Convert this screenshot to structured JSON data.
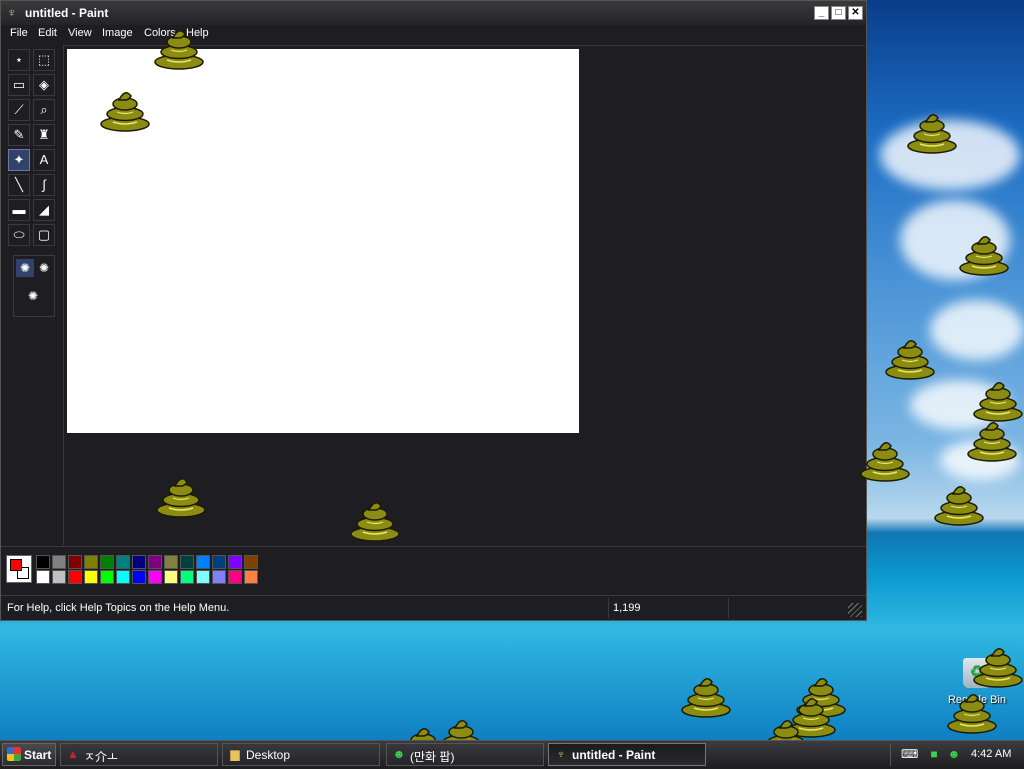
{
  "window": {
    "title": "untitled - Paint",
    "app_icon": "paint-brush-icon",
    "minimize_icon": "minimize-icon",
    "maximize_icon": "maximize-icon",
    "close_icon": "close-icon"
  },
  "menu": [
    "File",
    "Edit",
    "View",
    "Image",
    "Colors",
    "Help"
  ],
  "tools": [
    {
      "name": "free-form-select-icon",
      "glyph": "⋆"
    },
    {
      "name": "rect-select-icon",
      "glyph": "⬚"
    },
    {
      "name": "eraser-icon",
      "glyph": "▭"
    },
    {
      "name": "fill-bucket-icon",
      "glyph": "◈"
    },
    {
      "name": "color-picker-icon",
      "glyph": "⟋"
    },
    {
      "name": "magnifier-icon",
      "glyph": "⌕"
    },
    {
      "name": "pencil-icon",
      "glyph": "✎"
    },
    {
      "name": "brush-icon",
      "glyph": "♜"
    },
    {
      "name": "airbrush-icon",
      "glyph": "✦",
      "selected": true
    },
    {
      "name": "text-icon",
      "glyph": "A"
    },
    {
      "name": "line-icon",
      "glyph": "╲"
    },
    {
      "name": "curve-icon",
      "glyph": "∫"
    },
    {
      "name": "rectangle-icon",
      "glyph": "▬"
    },
    {
      "name": "polygon-icon",
      "glyph": "◢"
    },
    {
      "name": "ellipse-icon",
      "glyph": "⬭"
    },
    {
      "name": "rounded-rect-icon",
      "glyph": "▢"
    }
  ],
  "colors": {
    "foreground": "#ff0000",
    "background": "#ffffff",
    "row1": [
      "#000000",
      "#808080",
      "#800000",
      "#808000",
      "#008000",
      "#008080",
      "#000080",
      "#800080",
      "#808040",
      "#004040",
      "#0080ff",
      "#004080",
      "#8000ff",
      "#804000"
    ],
    "row2": [
      "#ffffff",
      "#c0c0c0",
      "#ff0000",
      "#ffff00",
      "#00ff00",
      "#00ffff",
      "#0000ff",
      "#ff00ff",
      "#ffff80",
      "#00ff80",
      "#80ffff",
      "#8080ff",
      "#ff0080",
      "#ff8040"
    ]
  },
  "status": {
    "help_text": "For Help, click Help Topics on the Help Menu.",
    "coords": "1,199"
  },
  "desktop": {
    "recycle_bin_label": "Recycle Bin",
    "recycle_bin_icon": "recycle-bin-icon"
  },
  "taskbar": {
    "start_label": "Start",
    "tasks": [
      {
        "label": "ㅈ介ㅗ",
        "icon": "warning-triangle-icon",
        "active": false
      },
      {
        "label": "Desktop",
        "icon": "folder-icon",
        "active": false
      },
      {
        "label": "(만화 팝)",
        "icon": "messenger-icon",
        "active": false
      },
      {
        "label": "untitled - Paint",
        "icon": "paint-brush-icon",
        "active": true
      }
    ],
    "tray_icons": [
      "keyboard-icon",
      "network-icon",
      "messenger-tray-icon"
    ],
    "clock": "4:42 AM"
  },
  "stamp_icon": "poop-stamp-icon"
}
